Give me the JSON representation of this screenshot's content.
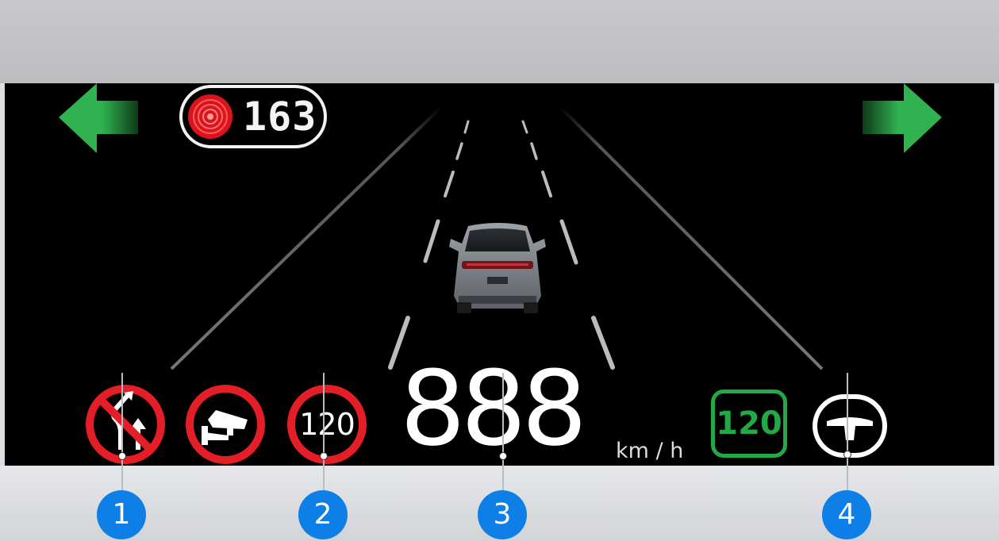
{
  "radar": {
    "distance": "163",
    "icon": "radar-icon"
  },
  "arrows": {
    "left": "left-arrow-icon",
    "right": "right-arrow-icon"
  },
  "vehicle": {
    "icon": "leading-car"
  },
  "signs": {
    "no_overtaking": {
      "icon": "no-overtaking-icon"
    },
    "speed_camera": {
      "icon": "speed-camera-icon"
    },
    "speed_limit": {
      "value": "120"
    }
  },
  "speed": {
    "value": "888",
    "unit": "km / h"
  },
  "cruise": {
    "set_speed": "120",
    "color": "#22a845"
  },
  "steering": {
    "icon": "steering-wheel-icon"
  },
  "callouts": [
    "1",
    "2",
    "3",
    "4"
  ],
  "colors": {
    "callout": "#0f7fe8",
    "warning_red": "#e41e26",
    "arrow_green": "#2fb24f"
  }
}
